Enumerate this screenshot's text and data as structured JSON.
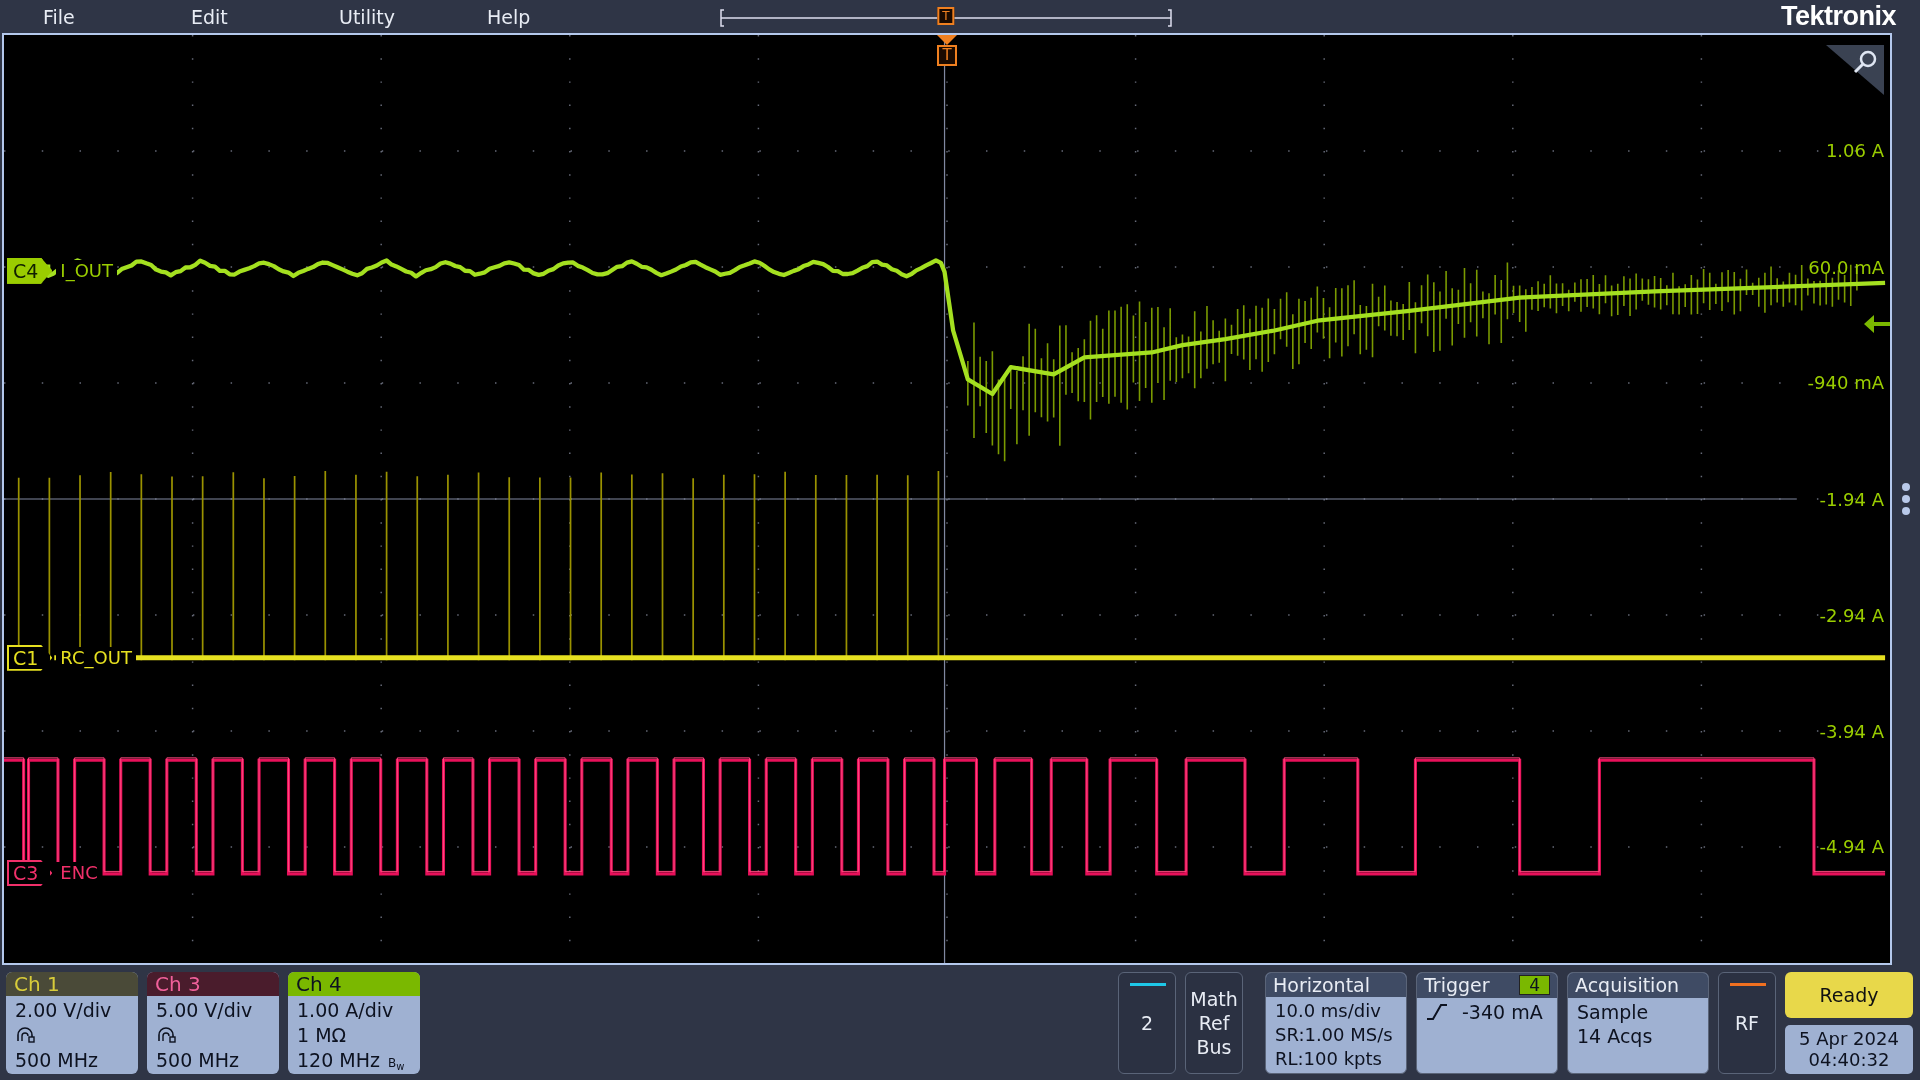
{
  "menu": [
    "File",
    "Edit",
    "Utility",
    "Help"
  ],
  "timeline": {
    "trigger_marker": "T"
  },
  "brand": "Tektronix",
  "graticule": {
    "trigger_marker": "T",
    "traces": [
      {
        "label": "C4",
        "name": "I_OUT",
        "color": "#9acd00",
        "selected": true
      },
      {
        "label": "C1",
        "name": "RC_OUT",
        "color": "#e6e020",
        "selected": false
      },
      {
        "label": "C3",
        "name": "ENC",
        "color": "#f0306a",
        "selected": false
      }
    ],
    "scale_labels": [
      "1.06 A",
      "60.0 mA",
      "-940 mA",
      "-1.94 A",
      "-2.94 A",
      "-3.94 A",
      "-4.94 A"
    ]
  },
  "channel_badges": [
    {
      "title": "Ch 1",
      "color": "#d8cc3a",
      "selected": false,
      "rows": [
        {
          "kind": "text",
          "text": "2.00 V/div"
        },
        {
          "kind": "probe"
        },
        {
          "kind": "text",
          "text": "500 MHz"
        }
      ]
    },
    {
      "title": "Ch 3",
      "color": "#f0609a",
      "selected": false,
      "rows": [
        {
          "kind": "text",
          "text": "5.00 V/div"
        },
        {
          "kind": "probe"
        },
        {
          "kind": "text",
          "text": "500 MHz"
        }
      ]
    },
    {
      "title": "Ch 4",
      "color": "#7ab800",
      "selected": true,
      "rows": [
        {
          "kind": "text",
          "text": "1.00 A/div"
        },
        {
          "kind": "text",
          "text": "1 MΩ"
        },
        {
          "kind": "bandwidth",
          "text": "120 MHz",
          "mark": "B$_{w}$"
        }
      ]
    }
  ],
  "add_channel": {
    "text": "2",
    "color": "#1ec8e8"
  },
  "math_ref_bus": [
    "Math",
    "Ref",
    "Bus"
  ],
  "horizontal": {
    "title": "Horizontal",
    "lines": [
      "10.0 ms/div",
      "SR:1.00 MS/s",
      "RL:100 kpts"
    ]
  },
  "trigger": {
    "title": "Trigger",
    "source": "4",
    "level": "-340 mA"
  },
  "acquisition": {
    "title": "Acquisition",
    "lines": [
      "Sample",
      "14 Acqs"
    ]
  },
  "rf": {
    "text": "RF",
    "color": "#f07020"
  },
  "run_state": "Ready",
  "date": "5 Apr 2024",
  "time": "04:40:32"
}
